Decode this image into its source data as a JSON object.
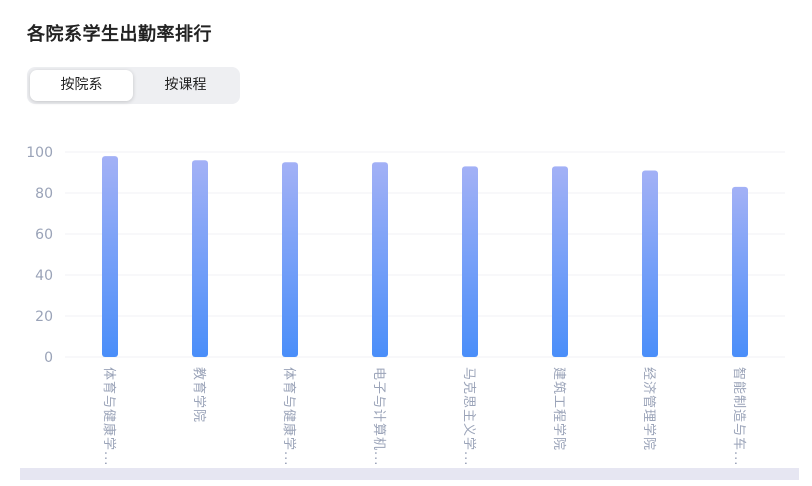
{
  "page": {
    "title": "各院系学生出勤率排行"
  },
  "toggle": {
    "options": [
      "按院系",
      "按课程"
    ],
    "selected": "按院系"
  },
  "colors": {
    "bar_top": "#a3b1f6",
    "bar_bottom": "#4a8ef9",
    "axis_text": "#9aa3b8",
    "grid": "#f0f1f5"
  },
  "chart_data": {
    "type": "bar",
    "title": "",
    "xlabel": "",
    "ylabel": "",
    "ylim": [
      0,
      100
    ],
    "yticks": [
      0,
      20,
      40,
      60,
      80,
      100
    ],
    "grid": true,
    "categories": [
      "体育与健康学...",
      "教育学院",
      "体育与健康学...",
      "电子与计算机...",
      "马克思主义学...",
      "建筑工程学院",
      "经济管理学院",
      "智能制造与车..."
    ],
    "values": [
      98,
      96,
      95,
      95,
      93,
      93,
      91,
      83
    ]
  }
}
